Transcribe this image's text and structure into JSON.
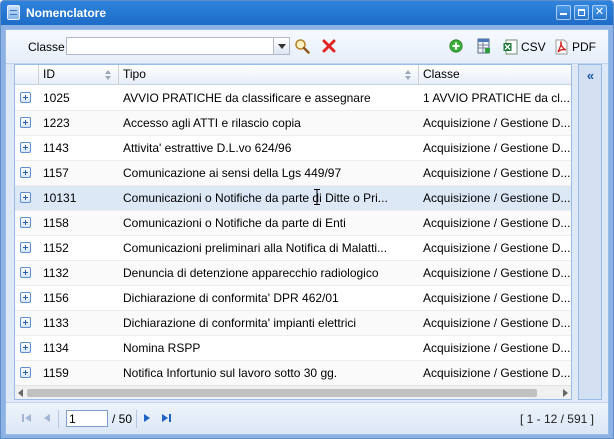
{
  "window": {
    "title": "Nomenclatore"
  },
  "toolbar": {
    "classe_label": "Classe",
    "classe_value": "",
    "csv_label": "CSV",
    "pdf_label": "PDF"
  },
  "grid": {
    "columns": [
      "ID",
      "Tipo",
      "Classe"
    ],
    "rows": [
      {
        "id": "1025",
        "tipo": "AVVIO PRATICHE da classificare e assegnare",
        "classe": "1 AVVIO PRATICHE da cl..."
      },
      {
        "id": "1223",
        "tipo": "Accesso agli ATTI e rilascio copia",
        "classe": "Acquisizione / Gestione D..."
      },
      {
        "id": "1143",
        "tipo": "Attivita' estrattive D.L.vo 624/96",
        "classe": "Acquisizione / Gestione D..."
      },
      {
        "id": "1157",
        "tipo": "Comunicazione ai sensi della Lgs 449/97",
        "classe": "Acquisizione / Gestione D..."
      },
      {
        "id": "10131",
        "tipo": "Comunicazioni o Notifiche da parte di Ditte o Pri...",
        "classe": "Acquisizione / Gestione D..."
      },
      {
        "id": "1158",
        "tipo": "Comunicazioni o Notifiche da parte di Enti",
        "classe": "Acquisizione / Gestione D..."
      },
      {
        "id": "1152",
        "tipo": "Comunicazioni preliminari alla Notifica di Malatti...",
        "classe": "Acquisizione / Gestione D..."
      },
      {
        "id": "1132",
        "tipo": "Denuncia di detenzione apparecchio radiologico",
        "classe": "Acquisizione / Gestione D..."
      },
      {
        "id": "1156",
        "tipo": "Dichiarazione di conformita' DPR 462/01",
        "classe": "Acquisizione / Gestione D..."
      },
      {
        "id": "1133",
        "tipo": "Dichiarazione di conformita' impianti elettrici",
        "classe": "Acquisizione / Gestione D..."
      },
      {
        "id": "1134",
        "tipo": "Nomina RSPP",
        "classe": "Acquisizione / Gestione D..."
      },
      {
        "id": "1159",
        "tipo": "Notifica Infortunio sul lavoro sotto 30 gg.",
        "classe": "Acquisizione / Gestione D..."
      }
    ]
  },
  "pager": {
    "current_page": "1",
    "of_pages": "/ 50",
    "info": "[ 1 - 12 / 591 ]"
  }
}
